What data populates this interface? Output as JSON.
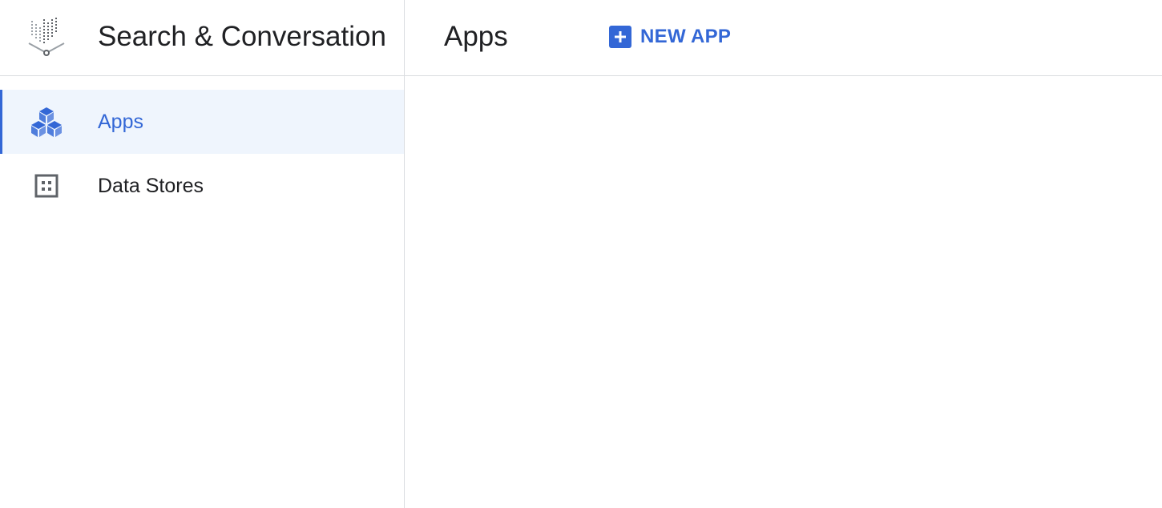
{
  "sidebar": {
    "product_name": "Search & Conversation",
    "logo_icon": "search-conversation-logo-icon",
    "items": [
      {
        "label": "Apps",
        "icon": "cubes-icon",
        "active": true
      },
      {
        "label": "Data Stores",
        "icon": "data-store-icon",
        "active": false
      }
    ]
  },
  "header": {
    "title": "Apps",
    "new_app_label": "NEW APP",
    "new_app_icon": "plus-box-icon"
  },
  "colors": {
    "accent": "#3367d6",
    "active_bg": "#eff5fd",
    "divider": "#dadce0",
    "text": "#202124",
    "icon_gray": "#5f6368"
  }
}
